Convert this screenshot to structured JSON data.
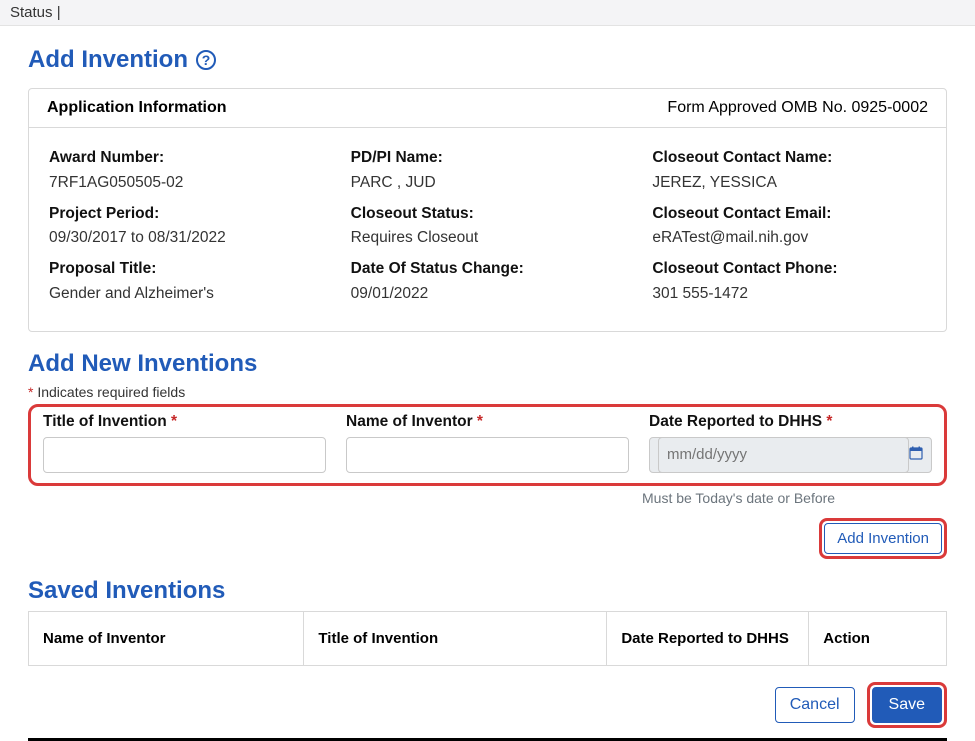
{
  "topbar": {
    "status_label": "Status"
  },
  "page": {
    "title": "Add Invention",
    "help_icon_char": "?"
  },
  "app_info": {
    "header_title": "Application Information",
    "form_approved": "Form Approved OMB No. 0925-0002",
    "col1": {
      "award_number_label": "Award Number:",
      "award_number": "7RF1AG050505-02",
      "project_period_label": "Project Period:",
      "project_period": "09/30/2017 to 08/31/2022",
      "proposal_title_label": "Proposal Title:",
      "proposal_title": "Gender and Alzheimer's"
    },
    "col2": {
      "pdpi_label": "PD/PI Name:",
      "pdpi": "PARC , JUD",
      "closeout_status_label": "Closeout Status:",
      "closeout_status": "Requires Closeout",
      "date_status_change_label": "Date Of Status Change:",
      "date_status_change": "09/01/2022"
    },
    "col3": {
      "contact_name_label": "Closeout Contact Name:",
      "contact_name": "JEREZ, YESSICA",
      "contact_email_label": "Closeout Contact Email:",
      "contact_email": "eRATest@mail.nih.gov",
      "contact_phone_label": "Closeout Contact Phone:",
      "contact_phone": "301 555-1472"
    }
  },
  "add_new": {
    "section_title": "Add New Inventions",
    "required_note_prefix": "* ",
    "required_note_text": "Indicates required fields",
    "title_label": "Title of Invention ",
    "name_label": "Name of Inventor ",
    "date_label": "Date Reported to DHHS ",
    "asterisk": "*",
    "date_placeholder": "mm/dd/yyyy",
    "date_hint": "Must be Today's date or Before",
    "add_button": "Add Invention"
  },
  "saved": {
    "section_title": "Saved Inventions",
    "headers": {
      "name": "Name of Inventor",
      "title": "Title of Invention",
      "date": "Date Reported to DHHS",
      "action": "Action"
    }
  },
  "footer": {
    "cancel": "Cancel",
    "save": "Save"
  }
}
